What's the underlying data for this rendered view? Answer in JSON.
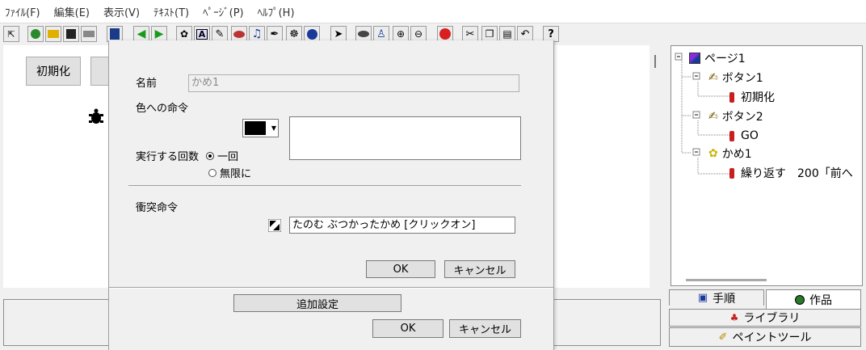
{
  "menu": [
    "ﾌｧｲﾙ(F)",
    "編集(E)",
    "表示(V)",
    "ﾃｷｽﾄ(T)",
    "ﾍﾟｰｼﾞ(P)",
    "ﾍﾙﾌﾟ(H)"
  ],
  "toolbar": {
    "help_glyph": "?"
  },
  "stage": {
    "button1_label": "初期化"
  },
  "tree": {
    "page": "ページ1",
    "button1": "ボタン1",
    "button1_cmd": "初期化",
    "button2": "ボタン2",
    "button2_cmd": "GO",
    "turtle": "かめ1",
    "turtle_cmd": "繰り返す　200「前へ"
  },
  "tabs": {
    "procedure": "手順",
    "works": "作品",
    "library": "ライブラリ",
    "paint": "ペイントツール"
  },
  "dialog": {
    "name_label": "名前",
    "name_value": "かめ1",
    "color_label": "色への命令",
    "repeat_label": "実行する回数",
    "radio_once": "一回",
    "radio_infinite": "無限に",
    "collision_label": "衝突命令",
    "collision_value": "たのむ ぶつかったかめ [クリックオン]",
    "ok": "OK",
    "cancel": "キャンセル",
    "extra": "追加設定",
    "ok2": "OK",
    "cancel2": "キャンセル",
    "color_swatch": "#000000"
  }
}
